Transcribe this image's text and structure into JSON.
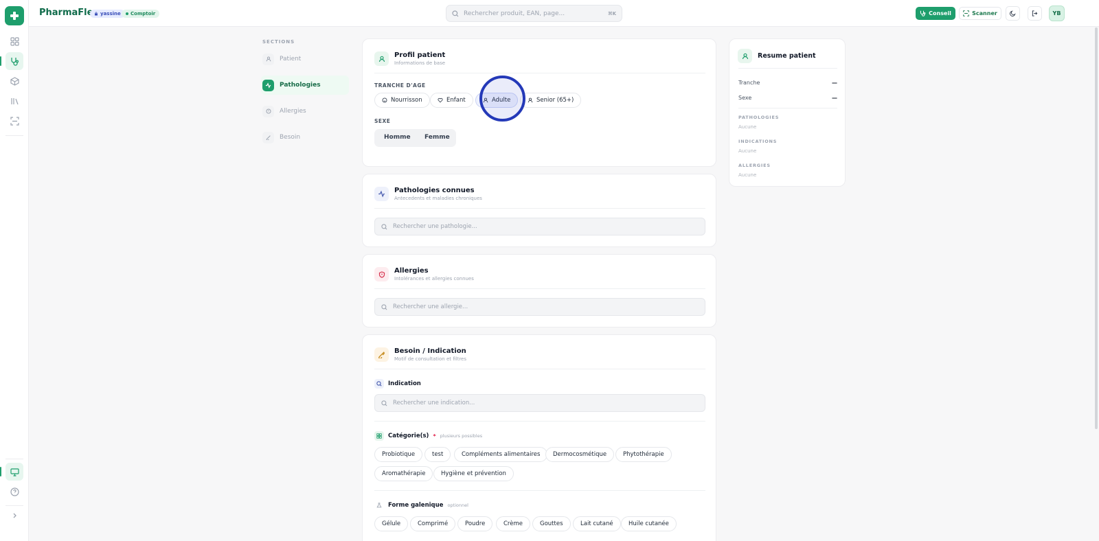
{
  "app": {
    "name": "PharmaFlex",
    "user": "yassine",
    "mode": "Comptoir"
  },
  "topbar": {
    "search_placeholder": "Rechercher produit, EAN, page...",
    "search_shortcut": "⌘K",
    "conseil_label": "Conseil",
    "scanner_label": "Scanner",
    "avatar_initials": "YB"
  },
  "sections": {
    "title": "SECTIONS",
    "items": [
      {
        "label": "Patient",
        "icon": "user-icon"
      },
      {
        "label": "Pathologies",
        "icon": "activity-icon",
        "active": true
      },
      {
        "label": "Allergies",
        "icon": "shield-icon"
      },
      {
        "label": "Besoin",
        "icon": "pill-icon"
      }
    ]
  },
  "profil": {
    "title": "Profil patient",
    "subtitle": "Informations de base",
    "age_label": "TRANCHE D'AGE",
    "age_options": [
      {
        "label": "Nourrisson",
        "icon": "baby-icon"
      },
      {
        "label": "Enfant",
        "icon": "heart-icon"
      },
      {
        "label": "Adulte",
        "icon": "user-icon"
      },
      {
        "label": "Senior (65+)",
        "icon": "user-icon"
      }
    ],
    "sexe_label": "SEXE",
    "sexe_options": [
      "Homme",
      "Femme"
    ]
  },
  "pathologies": {
    "title": "Pathologies connues",
    "subtitle": "Antecedents et maladies chroniques",
    "search_placeholder": "Rechercher une pathologie..."
  },
  "allergies": {
    "title": "Allergies",
    "subtitle": "Intolérances et allergies connues",
    "search_placeholder": "Rechercher une allergie..."
  },
  "besoin": {
    "title": "Besoin / Indication",
    "subtitle": "Motif de consultation et filtres",
    "indication_label": "Indication",
    "indication_placeholder": "Rechercher une indication...",
    "categories_label": "Catégorie(s)",
    "categories_required": "*",
    "categories_hint": "plusieurs possibles",
    "categories": [
      "Probiotique",
      "test",
      "Compléments alimentaires",
      "Dermocosmétique",
      "Phytothérapie",
      "Aromathérapie",
      "Hygiène et prévention"
    ],
    "forme_label": "Forme galenique",
    "forme_hint": "optionnel",
    "formes": [
      "Gélule",
      "Comprimé",
      "Poudre",
      "Crème",
      "Gouttes",
      "Lait cutané",
      "Huile cutanée"
    ]
  },
  "resume": {
    "title": "Resume patient",
    "tranche_label": "Tranche",
    "tranche_value": "—",
    "sexe_label": "Sexe",
    "sexe_value": "—",
    "pathologies_label": "PATHOLOGIES",
    "pathologies_value": "Aucune",
    "indications_label": "INDICATIONS",
    "indications_value": "Aucune",
    "allergies_label": "ALLERGIES",
    "allergies_value": "Aucune"
  },
  "colors": {
    "brand": "#1e9e6c",
    "brand_dark": "#0f6b4a",
    "click_ring": "#2439b8"
  }
}
